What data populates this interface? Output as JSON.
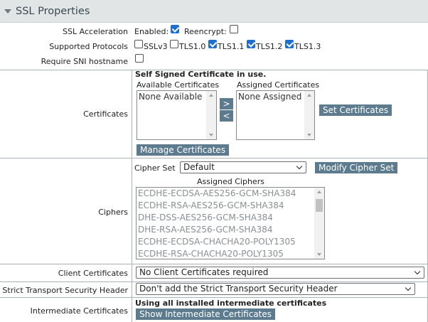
{
  "section": {
    "title": "SSL Properties"
  },
  "ssl_acceleration": {
    "label": "SSL Acceleration",
    "enabled_label": "Enabled:",
    "enabled_checked": true,
    "reencrypt_label": "Reencrypt:",
    "reencrypt_checked": false
  },
  "protocols": {
    "label": "Supported Protocols",
    "items": [
      {
        "label": "SSLv3",
        "checked": false
      },
      {
        "label": "TLS1.0",
        "checked": false
      },
      {
        "label": "TLS1.1",
        "checked": true
      },
      {
        "label": "TLS1.2",
        "checked": true
      },
      {
        "label": "TLS1.3",
        "checked": true
      }
    ]
  },
  "sni": {
    "label": "Require SNI hostname",
    "checked": false
  },
  "certificates": {
    "label": "Certificates",
    "notice": "Self Signed Certificate in use.",
    "available_label": "Available Certificates",
    "available_items": [
      "None Available"
    ],
    "assigned_label": "Assigned Certificates",
    "assigned_items": [
      "None Assigned"
    ],
    "move_right": ">",
    "move_left": "<",
    "set_button": "Set Certificates",
    "manage_button": "Manage Certificates"
  },
  "ciphers": {
    "label": "Ciphers",
    "cipher_set_label": "Cipher Set",
    "cipher_set_value": "Default",
    "modify_button": "Modify Cipher Set",
    "assigned_label": "Assigned Ciphers",
    "assigned_items": [
      "ECDHE-ECDSA-AES256-GCM-SHA384",
      "ECDHE-RSA-AES256-GCM-SHA384",
      "DHE-DSS-AES256-GCM-SHA384",
      "DHE-RSA-AES256-GCM-SHA384",
      "ECDHE-ECDSA-CHACHA20-POLY1305",
      "ECDHE-RSA-CHACHA20-POLY1305"
    ]
  },
  "client_certs": {
    "label": "Client Certificates",
    "value": "No Client Certificates required"
  },
  "hsts": {
    "label": "Strict Transport Security Header",
    "value": "Don't add the Strict Transport Security Header"
  },
  "intermediate": {
    "label": "Intermediate Certificates",
    "notice": "Using all installed intermediate certificates",
    "show_button": "Show Intermediate Certificates"
  },
  "colors": {
    "button_bg": "#5c7b8e",
    "checkbox_on": "#1f6fd1",
    "header_bg": "#e2e5e6"
  }
}
